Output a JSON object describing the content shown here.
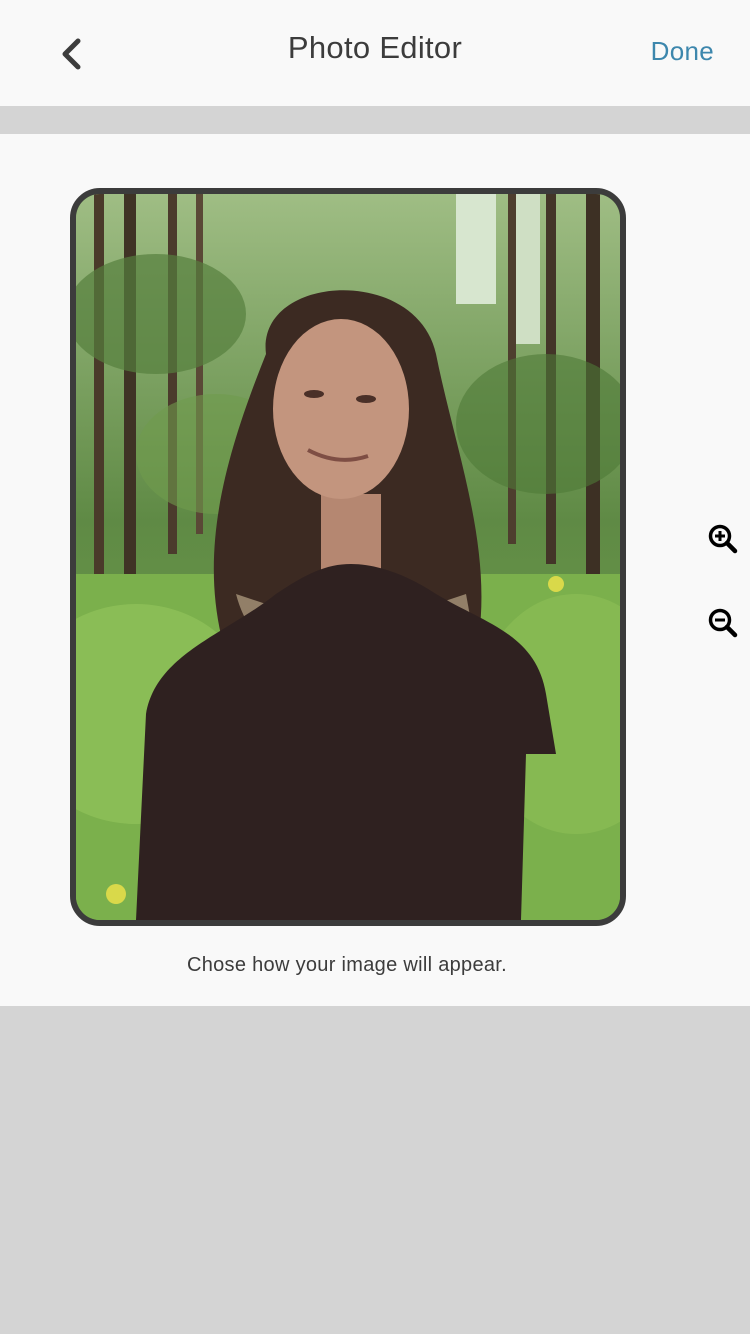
{
  "header": {
    "back_icon": "chevron-left-icon",
    "title": "Photo Editor",
    "done_label": "Done"
  },
  "editor": {
    "zoom_in_icon": "zoom-in-icon",
    "zoom_out_icon": "zoom-out-icon",
    "caption": "Chose how your image will appear."
  },
  "colors": {
    "accent": "#3d87ad",
    "text": "#3c3c3c",
    "background": "#f9f9f9",
    "separator": "#d4d4d4"
  }
}
